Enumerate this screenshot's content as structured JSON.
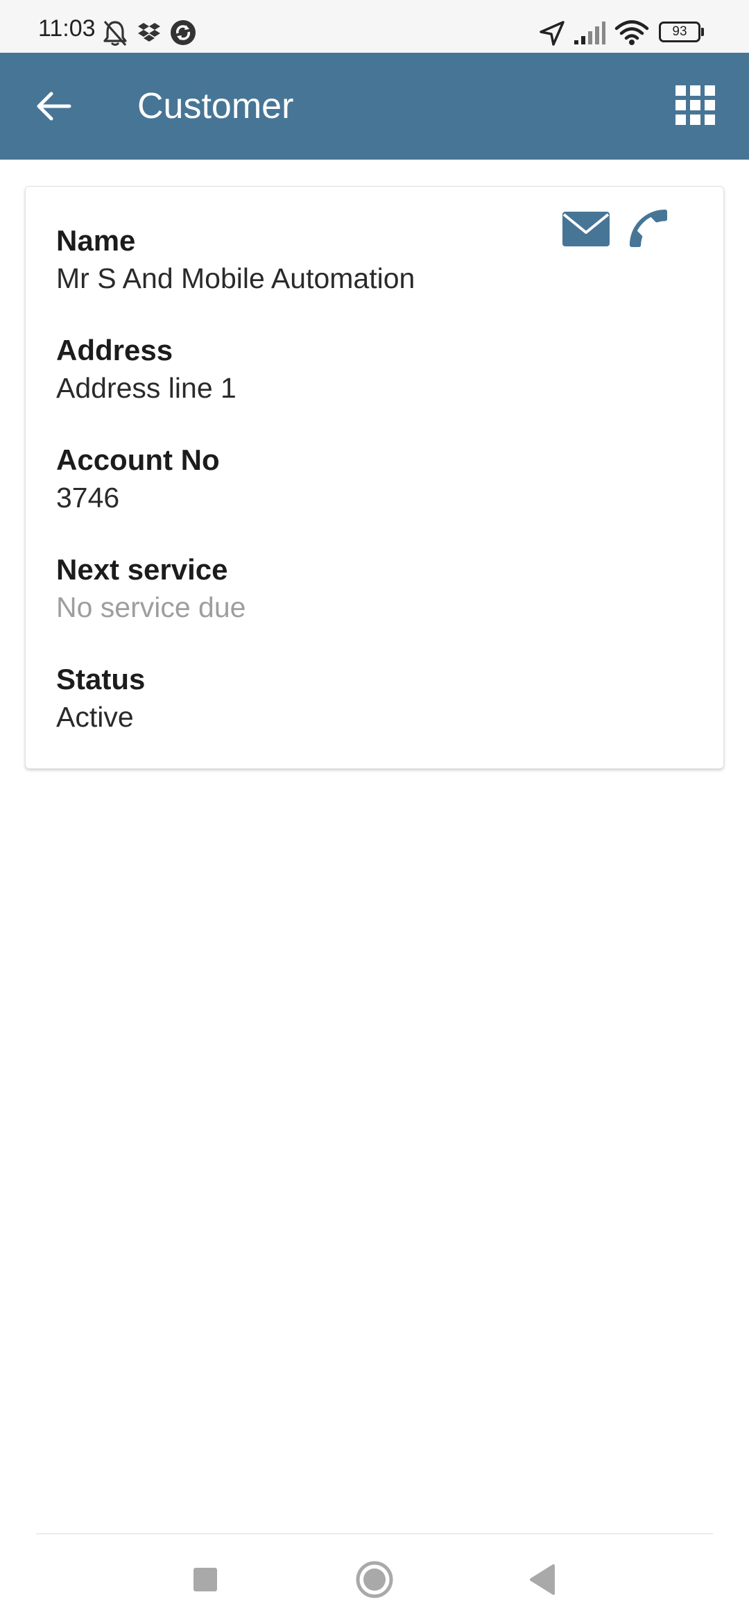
{
  "status_bar": {
    "time": "11:03",
    "battery_level": "93",
    "icons": [
      "bell-off-icon",
      "dropbox-icon",
      "sync-app-icon",
      "location-arrow-icon",
      "signal-icon",
      "wifi-icon",
      "battery-icon"
    ]
  },
  "app_bar": {
    "title": "Customer",
    "back_icon": "arrow-left-icon",
    "menu_icon": "apps-grid-icon",
    "color": "#477596"
  },
  "customer": {
    "name_label": "Name",
    "name_value": "Mr S And Mobile Automation",
    "address_label": "Address",
    "address_value": "Address line 1",
    "account_label": "Account No",
    "account_value": "3746",
    "service_label": "Next service",
    "service_value": "No service due",
    "status_label": "Status",
    "status_value": "Active",
    "actions": [
      "email-icon",
      "phone-icon"
    ]
  },
  "nav_bar": {
    "buttons": [
      "recents-square-icon",
      "home-circle-icon",
      "back-triangle-icon"
    ]
  }
}
